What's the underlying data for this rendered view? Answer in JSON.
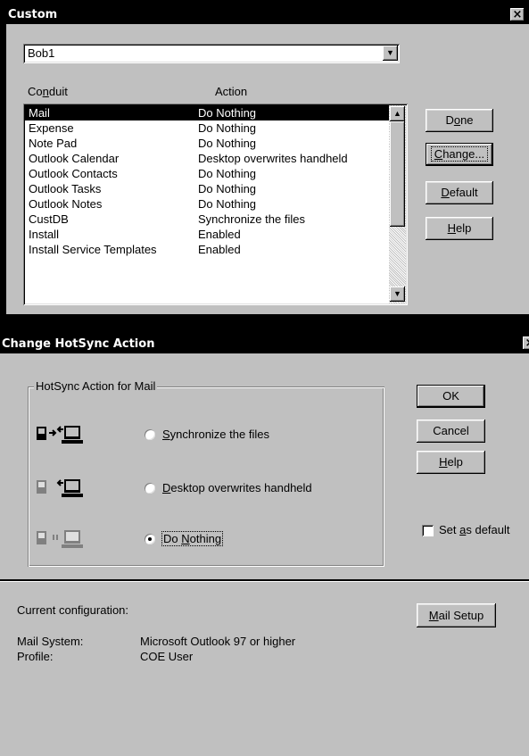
{
  "custom_dialog": {
    "title": "Custom",
    "close_glyph": "×",
    "user_select": {
      "value": "Bob1"
    },
    "columns": {
      "conduit_pre": "Co",
      "conduit_u": "n",
      "conduit_post": "duit",
      "action": "Action"
    },
    "rows": [
      {
        "conduit": "Mail",
        "action": "Do Nothing",
        "selected": true
      },
      {
        "conduit": "Expense",
        "action": "Do Nothing"
      },
      {
        "conduit": "Note Pad",
        "action": "Do Nothing"
      },
      {
        "conduit": "Outlook Calendar",
        "action": "Desktop overwrites handheld"
      },
      {
        "conduit": "Outlook Contacts",
        "action": "Do Nothing"
      },
      {
        "conduit": "Outlook Tasks",
        "action": "Do Nothing"
      },
      {
        "conduit": "Outlook Notes",
        "action": "Do Nothing"
      },
      {
        "conduit": "CustDB",
        "action": "Synchronize the files"
      },
      {
        "conduit": "Install",
        "action": "Enabled"
      },
      {
        "conduit": "Install Service Templates",
        "action": "Enabled"
      }
    ],
    "buttons": {
      "done": {
        "pre": "D",
        "u": "o",
        "post": "ne"
      },
      "change": {
        "pre": "",
        "u": "C",
        "post": "hange..."
      },
      "default": {
        "pre": "",
        "u": "D",
        "post": "efault"
      },
      "help": {
        "pre": "",
        "u": "H",
        "post": "elp"
      }
    }
  },
  "hotsync_dialog": {
    "title": "Change HotSync Action",
    "group_label": "HotSync Action for Mail",
    "options": {
      "sync": {
        "pre": "",
        "u": "S",
        "post": "ynchronize the files",
        "checked": false
      },
      "desktop": {
        "pre": "",
        "u": "D",
        "post": "esktop overwrites handheld",
        "checked": false
      },
      "nothing": {
        "pre": "Do ",
        "u": "N",
        "post": "othing",
        "checked": true
      }
    },
    "buttons": {
      "ok": "OK",
      "cancel": "Cancel",
      "help": {
        "pre": "",
        "u": "H",
        "post": "elp"
      },
      "mail_setup": {
        "pre": "",
        "u": "M",
        "post": "ail Setup"
      }
    },
    "set_default": {
      "pre": "Set ",
      "u": "a",
      "post": "s default",
      "checked": false
    },
    "config": {
      "heading": "Current configuration:",
      "mail_system_label": "Mail System:",
      "mail_system_value": "Microsoft Outlook 97 or higher",
      "profile_label": "Profile:",
      "profile_value": "COE User"
    }
  }
}
